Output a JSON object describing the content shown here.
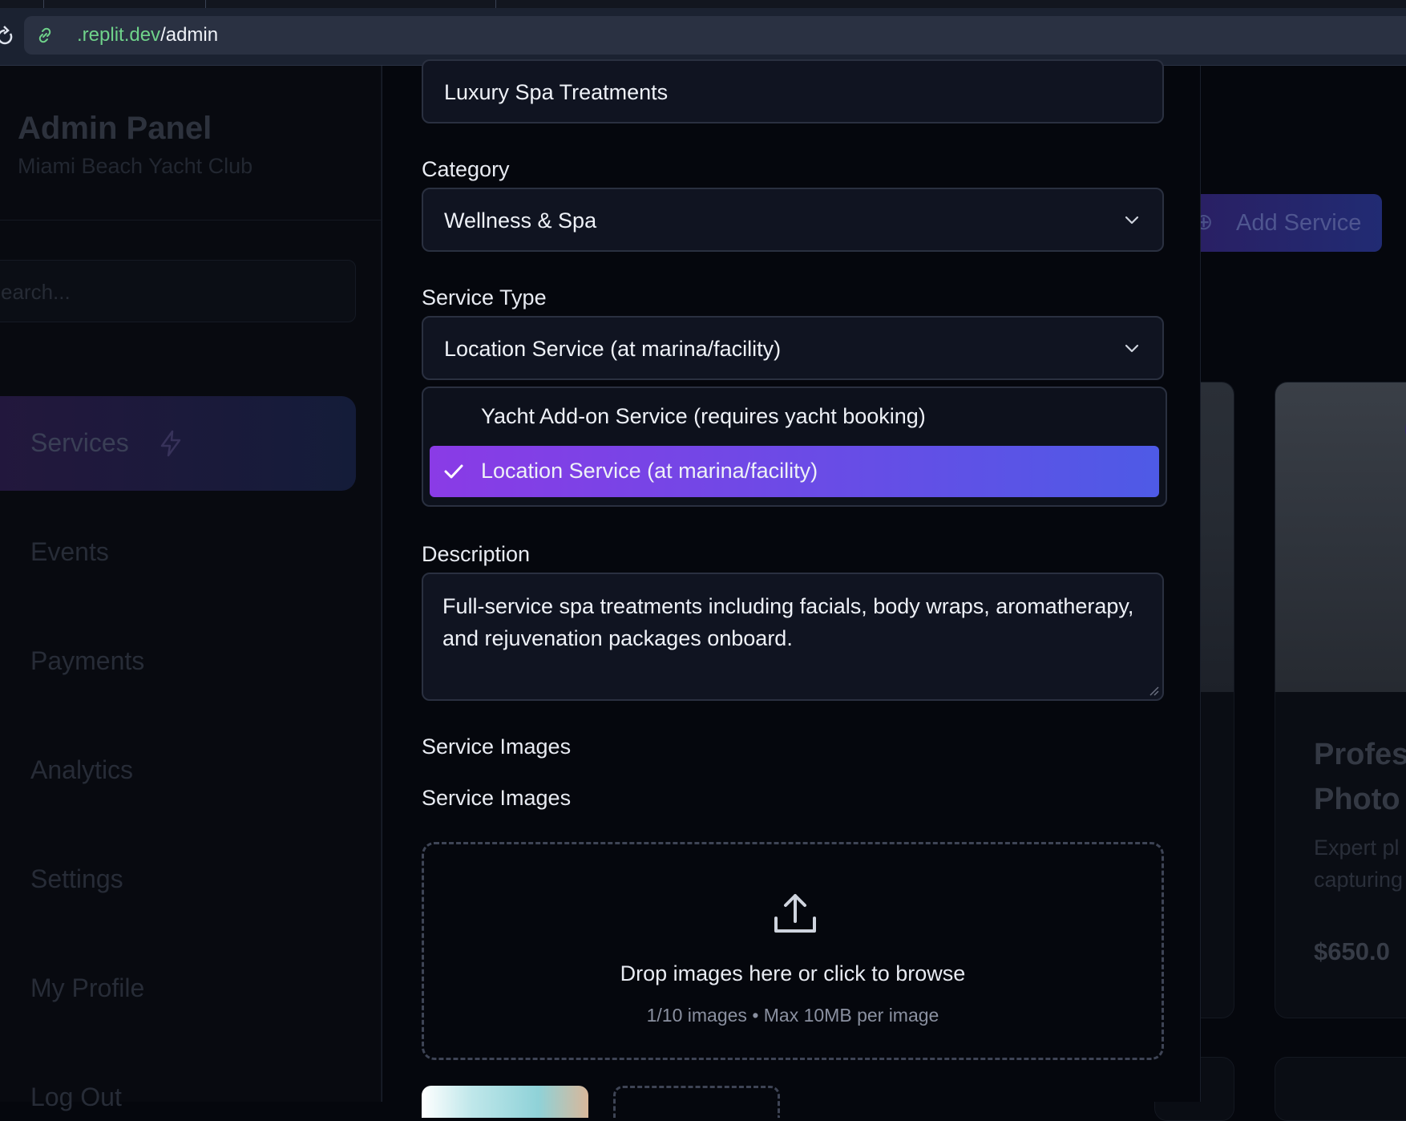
{
  "browser": {
    "url_host": ".replit.dev",
    "url_path": "/admin"
  },
  "sidebar": {
    "title": "Admin Panel",
    "subtitle": "Miami Beach Yacht Club",
    "search_placeholder": "earch...",
    "items": [
      {
        "label": "Services",
        "active": true
      },
      {
        "label": "Events"
      },
      {
        "label": "Payments"
      },
      {
        "label": "Analytics"
      },
      {
        "label": "Settings"
      },
      {
        "label": "My Profile"
      },
      {
        "label": "Log Out"
      }
    ]
  },
  "page": {
    "add_service_label": "Add Service",
    "card": {
      "title_lines": [
        "Profes",
        "Photo"
      ],
      "desc_lines": [
        "Expert pl",
        "capturing"
      ],
      "price": "$650.0"
    }
  },
  "form": {
    "name_value": "Luxury Spa Treatments",
    "category_label": "Category",
    "category_value": "Wellness & Spa",
    "service_type_label": "Service Type",
    "service_type_value": "Location Service (at marina/facility)",
    "service_type_options": [
      {
        "label": "Yacht Add-on Service (requires yacht booking)",
        "selected": false
      },
      {
        "label": "Location Service (at marina/facility)",
        "selected": true
      }
    ],
    "description_label": "Description",
    "description_value": "Full-service spa treatments including facials, body wraps, aromatherapy, and rejuvenation packages onboard.",
    "images_label_1": "Service Images",
    "images_label_2": "Service Images",
    "dropzone_text": "Drop images here or click to browse",
    "dropzone_hint": "1/10 images • Max 10MB per image"
  }
}
